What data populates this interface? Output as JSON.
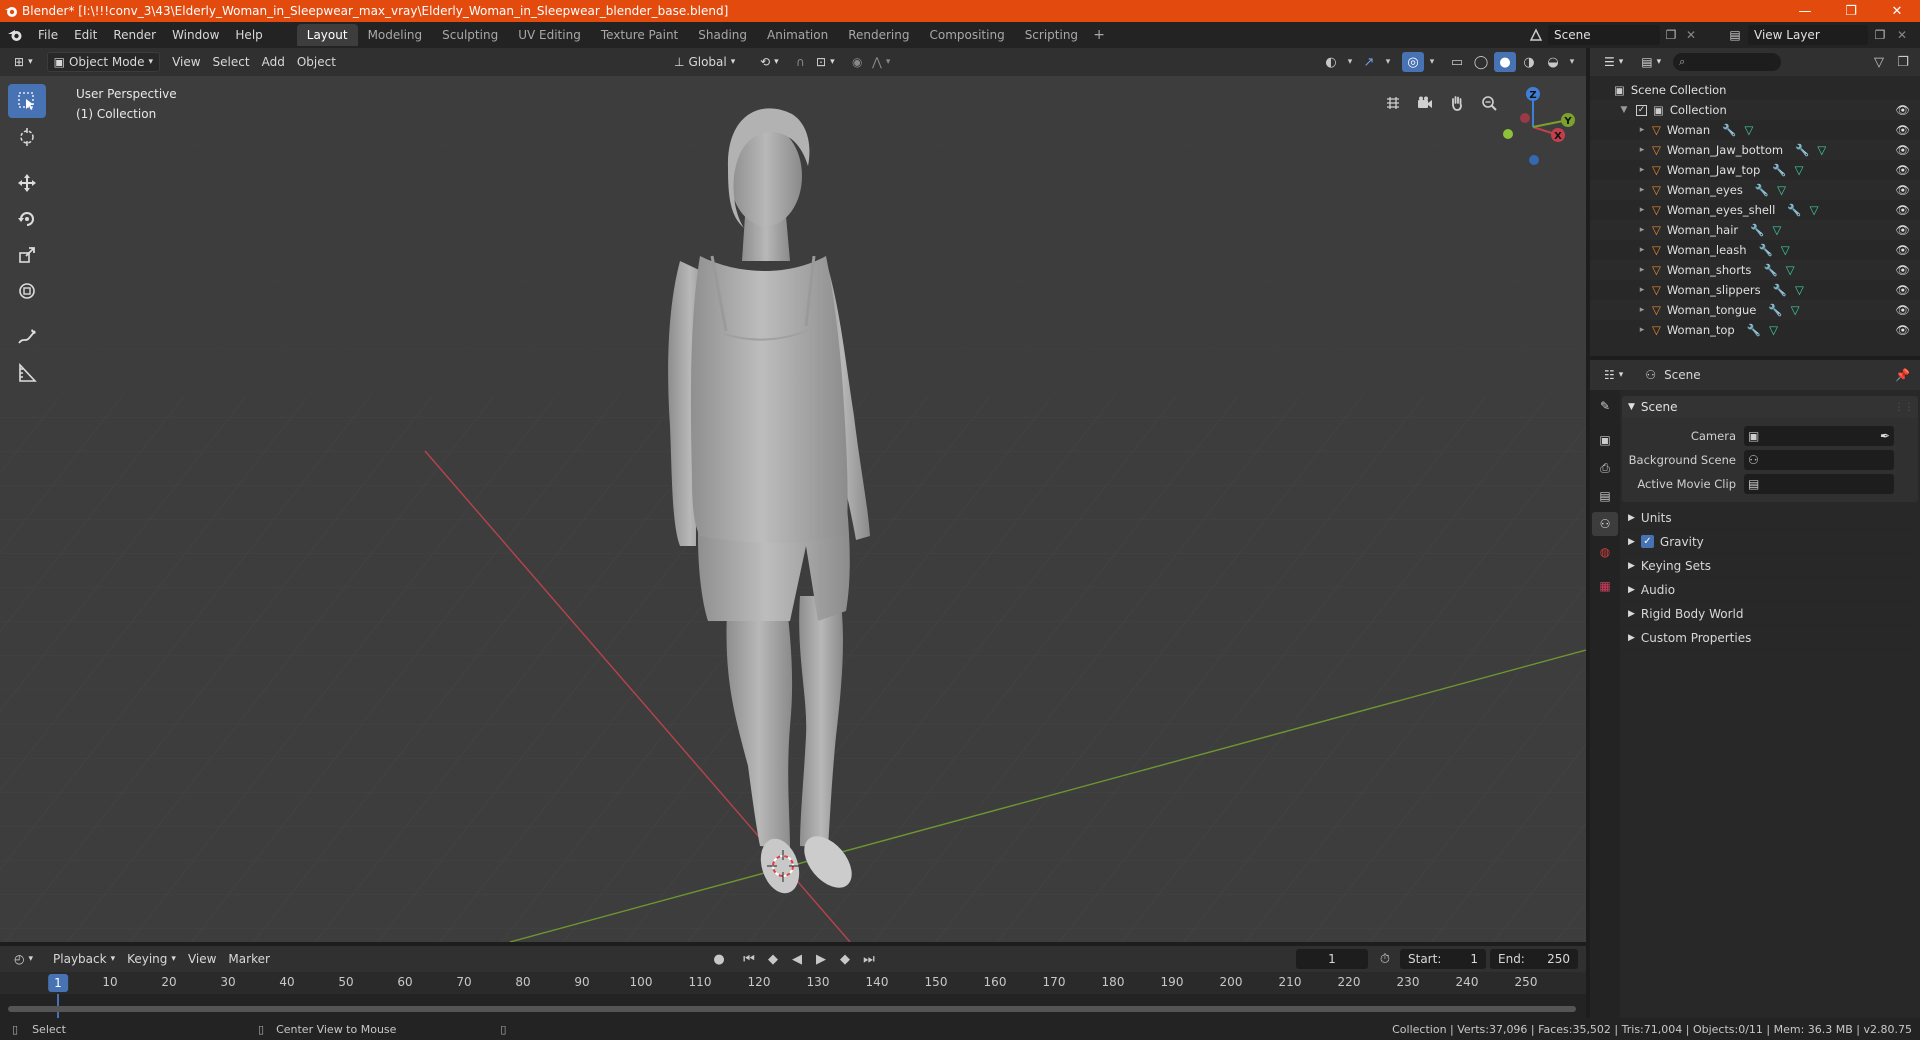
{
  "titlebar": {
    "title": "Blender* [I:\\!!!conv_3\\43\\Elderly_Woman_in_Sleepwear_max_vray\\Elderly_Woman_in_Sleepwear_blender_base.blend]",
    "minimize": "—",
    "maximize": "❐",
    "close": "✕"
  },
  "menu": [
    "File",
    "Edit",
    "Render",
    "Window",
    "Help"
  ],
  "workspaces": [
    "Layout",
    "Modeling",
    "Sculpting",
    "UV Editing",
    "Texture Paint",
    "Shading",
    "Animation",
    "Rendering",
    "Compositing",
    "Scripting"
  ],
  "workspace_add": "+",
  "scene_name": "Scene",
  "view_layer": "View Layer",
  "viewport_header": {
    "mode": "Object Mode",
    "menus": [
      "View",
      "Select",
      "Add",
      "Object"
    ],
    "transform_orientation": "Global"
  },
  "viewport": {
    "perspective": "User Perspective",
    "collection": "(1) Collection",
    "gizmo": {
      "z": "Z",
      "y": "Y",
      "x": "X"
    }
  },
  "timeline": {
    "menus": [
      "Playback",
      "Keying",
      "View",
      "Marker"
    ],
    "current_frame": "1",
    "start_label": "Start:",
    "start": "1",
    "end_label": "End:",
    "end": "250",
    "ticks": [
      "1",
      "10",
      "20",
      "30",
      "40",
      "50",
      "60",
      "70",
      "80",
      "90",
      "100",
      "110",
      "120",
      "130",
      "140",
      "150",
      "160",
      "170",
      "180",
      "190",
      "200",
      "210",
      "220",
      "230",
      "240",
      "250"
    ]
  },
  "statusbar": {
    "select": "Select",
    "center": "Center View to Mouse",
    "stats": "Collection | Verts:37,096 | Faces:35,502 | Tris:71,004 | Objects:0/11 | Mem: 36.3 MB | v2.80.75"
  },
  "outliner": {
    "scene_collection": "Scene Collection",
    "collection": "Collection",
    "objects": [
      "Woman",
      "Woman_Jaw_bottom",
      "Woman_Jaw_top",
      "Woman_eyes",
      "Woman_eyes_shell",
      "Woman_hair",
      "Woman_leash",
      "Woman_shorts",
      "Woman_slippers",
      "Woman_tongue",
      "Woman_top"
    ]
  },
  "properties": {
    "context": "Scene",
    "panel_title": "Scene",
    "camera_label": "Camera",
    "background_label": "Background Scene",
    "movieclip_label": "Active Movie Clip",
    "subpanels": {
      "units": "Units",
      "gravity": "Gravity",
      "keying": "Keying Sets",
      "audio": "Audio",
      "rigid": "Rigid Body World",
      "custom": "Custom Properties"
    }
  },
  "colors": {
    "accent": "#4772b3",
    "titlebar": "#e34a0e",
    "object_icon": "#e58a2f",
    "mesh_icon": "#3fd0a8",
    "x_axis": "#c2404c",
    "y_axis": "#7aa22c",
    "z_axis": "#3f7fd8"
  }
}
